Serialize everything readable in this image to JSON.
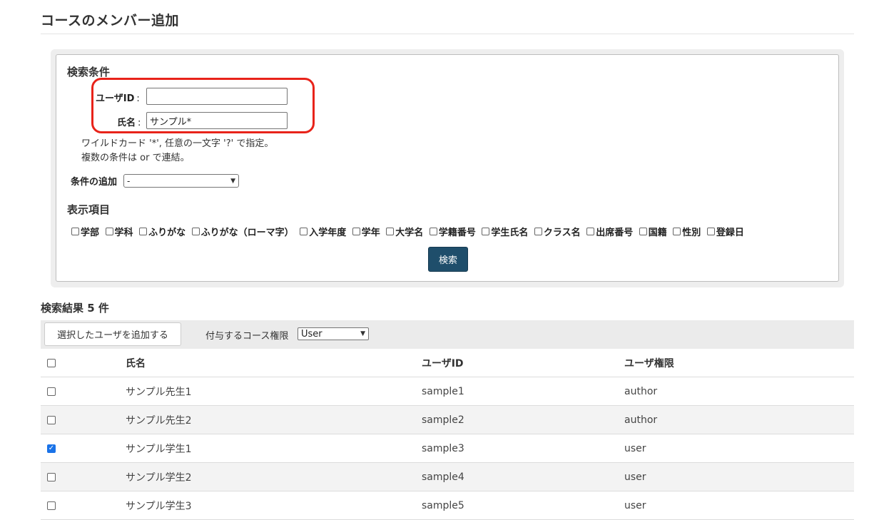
{
  "page": {
    "title": "コースのメンバー追加"
  },
  "search": {
    "section_title": "検索条件",
    "user_id_label": "ユーザID",
    "user_id_value": "",
    "name_label": "氏名",
    "name_value": "サンプル*",
    "colon": ":",
    "note_1": "ワイルドカード '*', 任意の一文字 '?' で指定。",
    "note_2": "複数の条件は or で連結。",
    "add_condition_label": "条件の追加",
    "add_condition_value": "-",
    "display_title": "表示項目",
    "columns": [
      "学部",
      "学科",
      "ふりがな",
      "ふりがな（ローマ字）",
      "入学年度",
      "学年",
      "大学名",
      "学籍番号",
      "学生氏名",
      "クラス名",
      "出席番号",
      "国籍",
      "性別",
      "登録日"
    ],
    "search_button": "検索"
  },
  "results": {
    "count_label": "検索結果 5 件",
    "add_button": "選択したユーザを追加する",
    "permission_label": "付与するコース権限",
    "permission_value": "User",
    "headers": {
      "name": "氏名",
      "user_id": "ユーザID",
      "role": "ユーザ権限"
    },
    "rows": [
      {
        "name": "サンプル先生1",
        "user_id": "sample1",
        "role": "author",
        "checked": false
      },
      {
        "name": "サンプル先生2",
        "user_id": "sample2",
        "role": "author",
        "checked": false
      },
      {
        "name": "サンプル学生1",
        "user_id": "sample3",
        "role": "user",
        "checked": true
      },
      {
        "name": "サンプル学生2",
        "user_id": "sample4",
        "role": "user",
        "checked": false
      },
      {
        "name": "サンプル学生3",
        "user_id": "sample5",
        "role": "user",
        "checked": false
      }
    ]
  },
  "colors": {
    "primary_button": "#1f4e6b",
    "highlight": "#e8231a",
    "checkbox_checked": "#1a73e8"
  }
}
